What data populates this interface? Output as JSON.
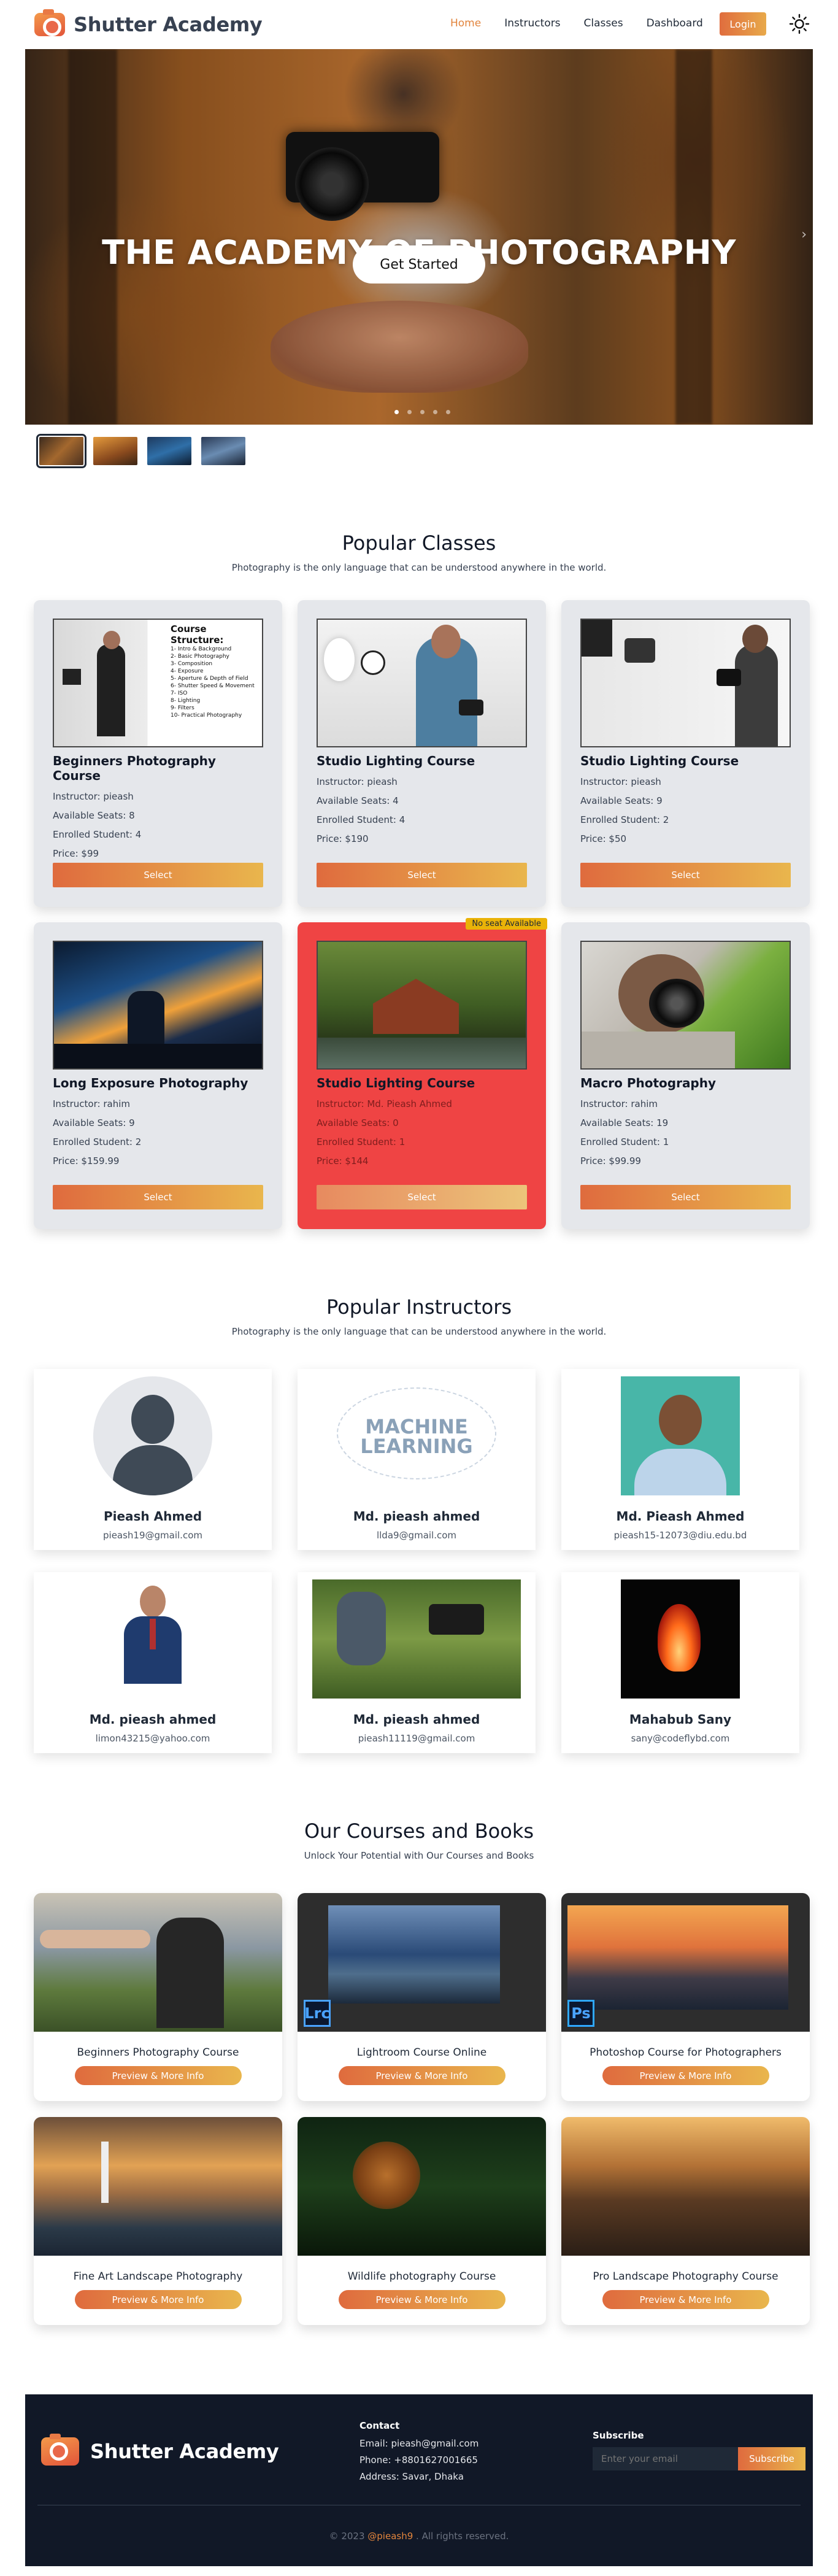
{
  "nav": {
    "brand": "Shutter Academy",
    "links": [
      "Home",
      "Instructors",
      "Classes",
      "Dashboard"
    ],
    "active_link": "Home",
    "login": "Login",
    "theme_icon": "sun-icon"
  },
  "hero": {
    "title": "THE ACADEMY OF PHOTOGRAPHY",
    "cta": "Get Started",
    "slides": 5,
    "active_slide": 1
  },
  "classes": {
    "title": "Popular Classes",
    "subtitle": "Photography is the only language that can be understood anywhere in the world.",
    "instructor_prefix": "Instructor: ",
    "seats_prefix": "Available Seats: ",
    "enrolled_prefix": "Enrolled Student: ",
    "price_prefix": "Price: ",
    "select_label": "Select",
    "badge": "No seat Available",
    "items": [
      {
        "title": "Beginners Photography Course",
        "instructor": "pieash",
        "seats": "8",
        "enrolled": "4",
        "price": "$99",
        "full": false
      },
      {
        "title": "Studio Lighting Course",
        "instructor": "pieash",
        "seats": "4",
        "enrolled": "4",
        "price": "$190",
        "full": false
      },
      {
        "title": "Studio Lighting Course",
        "instructor": "pieash",
        "seats": "9",
        "enrolled": "2",
        "price": "$50",
        "full": false
      },
      {
        "title": "Long Exposure Photography",
        "instructor": "rahim",
        "seats": "9",
        "enrolled": "2",
        "price": "$159.99",
        "full": false
      },
      {
        "title": "Studio Lighting Course",
        "instructor": "Md. Pieash Ahmed",
        "seats": "0",
        "enrolled": "1",
        "price": "$144",
        "full": true
      },
      {
        "title": "Macro Photography",
        "instructor": "rahim",
        "seats": "19",
        "enrolled": "1",
        "price": "$99.99",
        "full": false
      }
    ],
    "course_structure": {
      "heading": "Course Structure:",
      "lines": [
        "1- Intro & Background",
        "2- Basic Photography",
        "3- Composition",
        "4- Exposure",
        "5- Aperture & Depth of Field",
        "6- Shutter Speed & Movement",
        "7- ISO",
        "8- Lighting",
        "9- Filters",
        "10- Practical Photography"
      ]
    }
  },
  "instructors": {
    "title": "Popular Instructors",
    "subtitle": "Photography is the only language that can be understood anywhere in the world.",
    "ml_text": [
      "MACHINE",
      "LEARNING"
    ],
    "items": [
      {
        "name": "Pieash Ahmed",
        "email": "pieash19@gmail.com"
      },
      {
        "name": "Md. pieash ahmed",
        "email": "llda9@gmail.com"
      },
      {
        "name": "Md. Pieash Ahmed",
        "email": "pieash15-12073@diu.edu.bd"
      },
      {
        "name": "Md. pieash ahmed",
        "email": "limon43215@yahoo.com"
      },
      {
        "name": "Md. pieash ahmed",
        "email": "pieash11119@gmail.com"
      },
      {
        "name": "Mahabub Sany",
        "email": "sany@codeflybd.com"
      }
    ]
  },
  "books": {
    "title": "Our Courses and Books",
    "subtitle": "Unlock Your Potential with Our Courses and Books",
    "button": "Preview & More Info",
    "items": [
      {
        "title": "Beginners Photography Course",
        "badge": ""
      },
      {
        "title": "Lightroom Course Online",
        "badge": "Lrc"
      },
      {
        "title": "Photoshop Course for Photographers",
        "badge": "Ps"
      },
      {
        "title": "Fine Art Landscape Photography",
        "badge": ""
      },
      {
        "title": "Wildlife photography Course",
        "badge": ""
      },
      {
        "title": "Pro Landscape Photography Course",
        "badge": ""
      }
    ]
  },
  "footer": {
    "brand": "Shutter Academy",
    "contact_heading": "Contact",
    "email": "Email: pieash@gmail.com",
    "phone": "Phone: +8801627001665",
    "address": "Address: Savar, Dhaka",
    "subscribe_heading": "Subscribe",
    "subscribe_placeholder": "Enter your email",
    "subscribe_button": "Subscribe",
    "copy_prefix": "© 2023 ",
    "copy_handle": "@pieash9",
    "copy_suffix": " . All rights reserved."
  }
}
